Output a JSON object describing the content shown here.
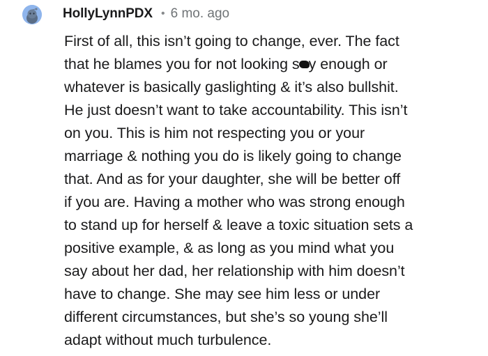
{
  "comment": {
    "username": "HollyLynnPDX",
    "separator": "•",
    "age": "6 mo. ago",
    "avatar_icon": "snoo-avatar-icon",
    "avatar_color": "#8fb5ec",
    "lines": [
      "First of all, this isn’t going to change, ever. The fact",
      [
        "that he blames you for not looking s",
        "y enough or"
      ],
      "whatever is basically gaslighting & it’s also bullshit.",
      "He just doesn’t want to take accountability. This isn’t",
      "on you. This is him not respecting you or your",
      "marriage & nothing you do is likely going to change",
      "that. And as for your daughter, she will be better off",
      "if you are. Having a mother who was strong enough",
      "to stand up for herself & leave a toxic situation sets a",
      "positive example, & as long as you mind what you",
      "say about her dad, her relationship with him doesn’t",
      "have to change. She may see him less or under",
      "different circumstances, but she’s so young she’ll",
      "adapt without much turbulence."
    ]
  }
}
